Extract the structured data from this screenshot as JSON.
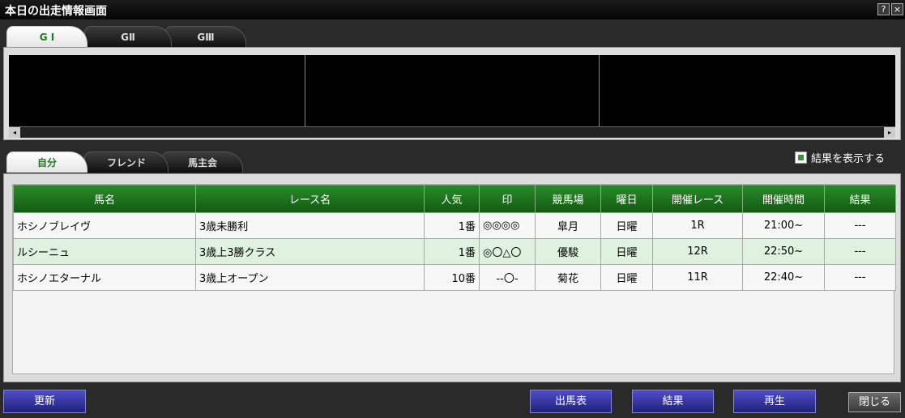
{
  "window": {
    "title": "本日の出走情報画面",
    "help_label": "?",
    "close_label": "×"
  },
  "grade_tabs": [
    {
      "label": "G I",
      "active": true
    },
    {
      "label": "GⅡ",
      "active": false
    },
    {
      "label": "GⅢ",
      "active": false
    }
  ],
  "grade_scrollbar": {
    "left_arrow": "◂",
    "right_arrow": "▸"
  },
  "owner_tabs": [
    {
      "label": "自分",
      "active": true
    },
    {
      "label": "フレンド",
      "active": false
    },
    {
      "label": "馬主会",
      "active": false
    }
  ],
  "show_results": {
    "label": "結果を表示する",
    "checked": true
  },
  "table": {
    "headers": [
      "馬名",
      "レース名",
      "人気",
      "印",
      "競馬場",
      "曜日",
      "開催レース",
      "開催時間",
      "結果"
    ],
    "rows": [
      [
        "ホシノブレイヴ",
        "3歳未勝利",
        "1番",
        "◎◎◎◎",
        "皐月",
        "日曜",
        "1R",
        "21:00~",
        "---"
      ],
      [
        "ルシーニュ",
        "3歳上3勝クラス",
        "1番",
        "◎〇△〇",
        "優駿",
        "日曜",
        "12R",
        "22:50~",
        "---"
      ],
      [
        "ホシノエターナル",
        "3歳上オープン",
        "10番",
        "--〇-",
        "菊花",
        "日曜",
        "11R",
        "22:40~",
        "---"
      ]
    ]
  },
  "buttons": {
    "refresh": "更新",
    "race_card": "出馬表",
    "results": "結果",
    "replay": "再生",
    "close": "閉じる"
  }
}
